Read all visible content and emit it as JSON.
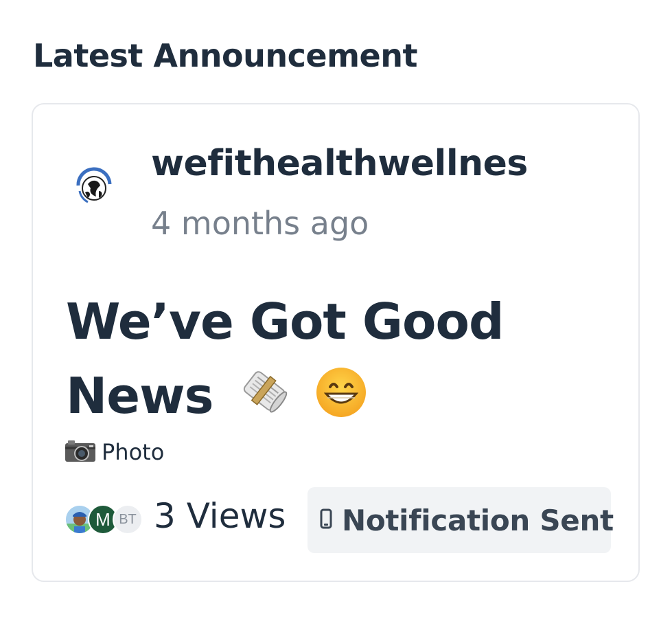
{
  "section": {
    "title": "Latest Announcement"
  },
  "announcement": {
    "author": "wefithealthwellnes",
    "time_ago": "4 months ago",
    "headline": "We’ve Got Good News",
    "headline_emojis": [
      "rolled-newspaper-icon",
      "grinning-face-icon"
    ],
    "attachment": {
      "icon": "camera-icon",
      "label": "Photo"
    },
    "viewers": [
      {
        "type": "photo",
        "label": ""
      },
      {
        "type": "initial",
        "label": "M",
        "color": "#1e5a3a"
      },
      {
        "type": "initial",
        "label": "BT",
        "color": "#eceef1"
      }
    ],
    "views_label": "3 Views",
    "notification": {
      "icon": "phone-icon",
      "label": "Notification Sent"
    }
  },
  "colors": {
    "text": "#1f2d3d",
    "muted": "#77808c",
    "badge_bg": "#f1f3f5",
    "card_border": "#e6e8ec"
  }
}
